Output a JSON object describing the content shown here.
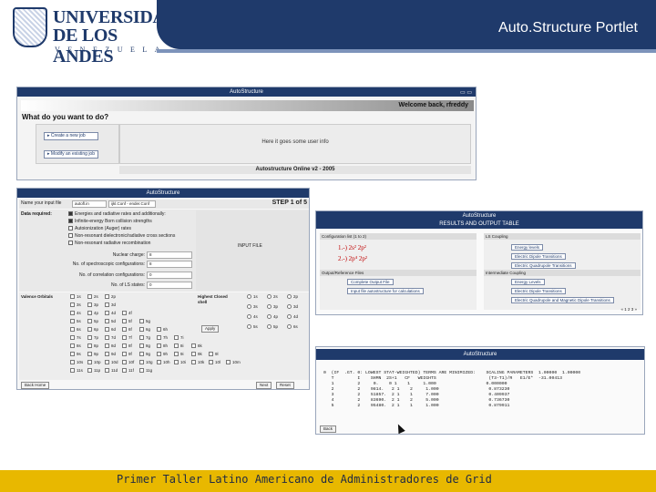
{
  "header": {
    "title": "Auto.Structure Portlet",
    "logo_line1": "UNIVERSIDAD",
    "logo_line2": "DE LOS ANDES",
    "logo_line3": "VENEZUELA"
  },
  "screen1": {
    "title": "AutoStructure",
    "welcome": "Welcome back, rfreddy",
    "question": "What do you want to do?",
    "button_create": "Create a new job",
    "button_modify": "Modify an existing job",
    "info": "Here it goes some user info",
    "footer": "Autostructure Online v2 - 2005"
  },
  "screen2": {
    "title": "AutoStructure",
    "input_file_label": "Name your input file",
    "input_file_value": "autofl.in",
    "input_file_value2": "ijkl.Conf - ender.Conf",
    "step": "STEP 1 of 5",
    "data_required_label": "Data required:",
    "options": [
      {
        "label": "Energies and radiative rates and additionally:",
        "checked": true
      },
      {
        "label": "Infinite-energy Born collision strengths",
        "checked": true
      },
      {
        "label": "Autoionization (Auger) rates",
        "checked": false
      },
      {
        "label": "Non-resonant dielectronic/radiative cross sections",
        "checked": false
      },
      {
        "label": "Non-resonant radiative recombination",
        "checked": false
      }
    ],
    "input_file_panel": "INPUT FILE",
    "fields": [
      {
        "label": "Nuclear charge:",
        "value": "8"
      },
      {
        "label": "No. of spectroscopic configurations:",
        "value": "8"
      },
      {
        "label": "No. of correlation configurations:",
        "value": "0"
      },
      {
        "label": "No. of LS states:",
        "value": "0"
      }
    ],
    "valence_label": "Valence Orbitals",
    "highest_closed_shell": "Highest Closed shell",
    "orbital_rows": [
      [
        "1s",
        "2s",
        "2p"
      ],
      [
        "3s",
        "3p",
        "3d"
      ],
      [
        "4s",
        "4p",
        "4d",
        "4f"
      ],
      [
        "5s",
        "5p",
        "5d",
        "5f",
        "5g"
      ],
      [
        "6s",
        "6p",
        "6d",
        "6f",
        "6g",
        "6h"
      ],
      [
        "7s",
        "7p",
        "7d",
        "7f",
        "7g",
        "7h",
        "7i"
      ],
      [
        "8s",
        "8p",
        "8d",
        "8f",
        "8g",
        "8h",
        "8i",
        "8k"
      ],
      [
        "9s",
        "9p",
        "9d",
        "9f",
        "9g",
        "9h",
        "9i",
        "9k",
        "9l"
      ],
      [
        "10s",
        "10p",
        "10d",
        "10f",
        "10g",
        "10h",
        "10i",
        "10k",
        "10l",
        "10m"
      ],
      [
        "11s",
        "11p",
        "11d",
        "11f",
        "11g"
      ]
    ],
    "closed_shell_options": [
      "1s",
      "2s",
      "2p",
      "3s",
      "3p",
      "3d",
      "4s",
      "4p",
      "4d",
      "5s",
      "5p",
      "6s"
    ],
    "apply_button": "Apply",
    "back_button": "Back Home",
    "next_button": "Next",
    "reset_button": "Reset"
  },
  "screen3": {
    "title": "AutoStructure",
    "table_title": "RESULTS AND OUTPUT TABLE",
    "config_header": "Configuration list (1 to 2)",
    "ls_header": "LS Coupling",
    "config1": "1.-) 2s² 2p²",
    "config2": "2.-) 2p⁴ 2p²",
    "output_header": "Output/Reference Files",
    "ic_header": "Intermediate Coupling",
    "ls_buttons": [
      "Energy levels",
      "Electric Dipole Transitions",
      "Electric Quadrupole Transitions"
    ],
    "output_buttons": [
      "Complete Output File",
      "Input file autostructure for calculations"
    ],
    "ic_buttons": [
      "Energy Levels",
      "Electric Dipole Transitions",
      "Electric Quadrupole and Magnetic Dipole Transitions"
    ],
    "pagination": "« 1 2 3 »"
  },
  "screen4": {
    "title": "AutoStructure",
    "data_lines": [
      "0  (IF  .GT. 0: LOWEST STAT-WEIGHTED) TERMS ARE MINIMIZED:    SCALING PARAMETERS  1.00000  1.00000",
      "   T         I    SHMN  2S+1   CF   WEIGHTS                    (T3-T1)/R   E1/E*  -31.00413",
      "   1         2     0.    0 1    1     1.000                   0.000000",
      "   2         2    9814.   2 1    2     1.000                   0.873230",
      "   3         2    51857.  2 1    1     7.000                   0.409937",
      "   4         2    83690.  2 1    2     5.000                   0.736730",
      "   5         2    95480.  2 1    1     1.000                   0.879911"
    ],
    "back_button": "Back"
  },
  "footer": {
    "text": "Primer Taller Latino Americano de Administradores de Grid"
  },
  "colors": {
    "brand_navy": "#1f3a6b",
    "footer_gold": "#e8b800"
  }
}
